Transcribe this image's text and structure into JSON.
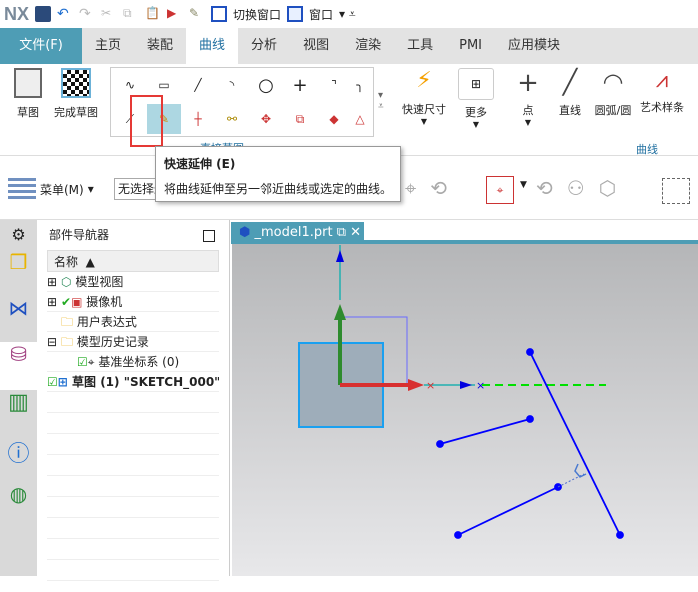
{
  "app": {
    "logo": "NX",
    "switch_window": "切换窗口",
    "window": "窗口"
  },
  "tabs": [
    "文件(F)",
    "主页",
    "装配",
    "曲线",
    "分析",
    "视图",
    "渲染",
    "工具",
    "PMI",
    "应用模块"
  ],
  "ribbon": {
    "sketch": "草图",
    "finish_sketch": "完成草图",
    "quick_dimension": "快速尺寸",
    "more": "更多",
    "point": "点",
    "line": "直线",
    "arc_circle": "圆弧/圆",
    "studio_spline": "艺术样条",
    "group_direct_sketch": "直接草图",
    "group_curve": "曲线"
  },
  "toolbar2": {
    "menu": "菜单(M)",
    "selection_filter": "无选择过滤器"
  },
  "tooltip": {
    "title": "快速延伸 (E)",
    "description": "将曲线延伸至另一邻近曲线或选定的曲线。"
  },
  "navigator": {
    "title": "部件导航器",
    "column_name": "名称",
    "items": [
      {
        "label": "模型视图"
      },
      {
        "label": "摄像机"
      },
      {
        "label": "用户表达式"
      },
      {
        "label": "模型历史记录"
      },
      {
        "label": "基准坐标系 (0)"
      },
      {
        "label": "草图 (1) \"SKETCH_000\""
      }
    ]
  },
  "viewport": {
    "tab_label": "_model1.prt"
  },
  "colors": {
    "accent": "#4e9db5",
    "sketch_curve": "#0000ff",
    "highlight": "#e53935"
  }
}
